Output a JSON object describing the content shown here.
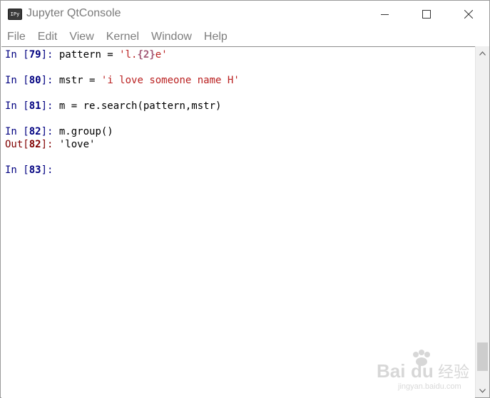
{
  "window": {
    "title": "Jupyter QtConsole",
    "app_icon_text": "IPy"
  },
  "menu": [
    "File",
    "Edit",
    "View",
    "Kernel",
    "Window",
    "Help"
  ],
  "console": {
    "lines": [
      {
        "prompt_open": "In [",
        "num": "79",
        "prompt_close": "]: ",
        "code_pre": "pattern = ",
        "str_a": "'l.",
        "brace": "{2}",
        "str_b": "e'"
      },
      {
        "prompt_open": "In [",
        "num": "80",
        "prompt_close": "]: ",
        "code_pre": "mstr = ",
        "str": "'i love someone name H'"
      },
      {
        "prompt_open": "In [",
        "num": "81",
        "prompt_close": "]: ",
        "code": "m = re.search(pattern,mstr)"
      },
      {
        "prompt_open": "In [",
        "num": "82",
        "prompt_close": "]: ",
        "code": "m.group()"
      },
      {
        "prompt_open": "Out[",
        "num": "82",
        "prompt_close": "]: ",
        "code": "'love'"
      },
      {
        "prompt_open": "In [",
        "num": "83",
        "prompt_close": "]: ",
        "code": ""
      }
    ]
  },
  "watermark": {
    "brand": "Bai",
    "brand2": "du",
    "suffix": "经验",
    "sub": "jingyan.baidu.com"
  },
  "colors": {
    "in_prompt": "#000080",
    "out_prompt": "#800000",
    "string": "#ba2121",
    "brace": "#a45a77",
    "menu_text": "#7d7d7d",
    "title_text": "#7a7a7a"
  },
  "icons": [
    "ipython-app-icon",
    "minimize-icon",
    "maximize-icon",
    "close-icon",
    "scroll-up-icon",
    "scroll-down-icon"
  ]
}
